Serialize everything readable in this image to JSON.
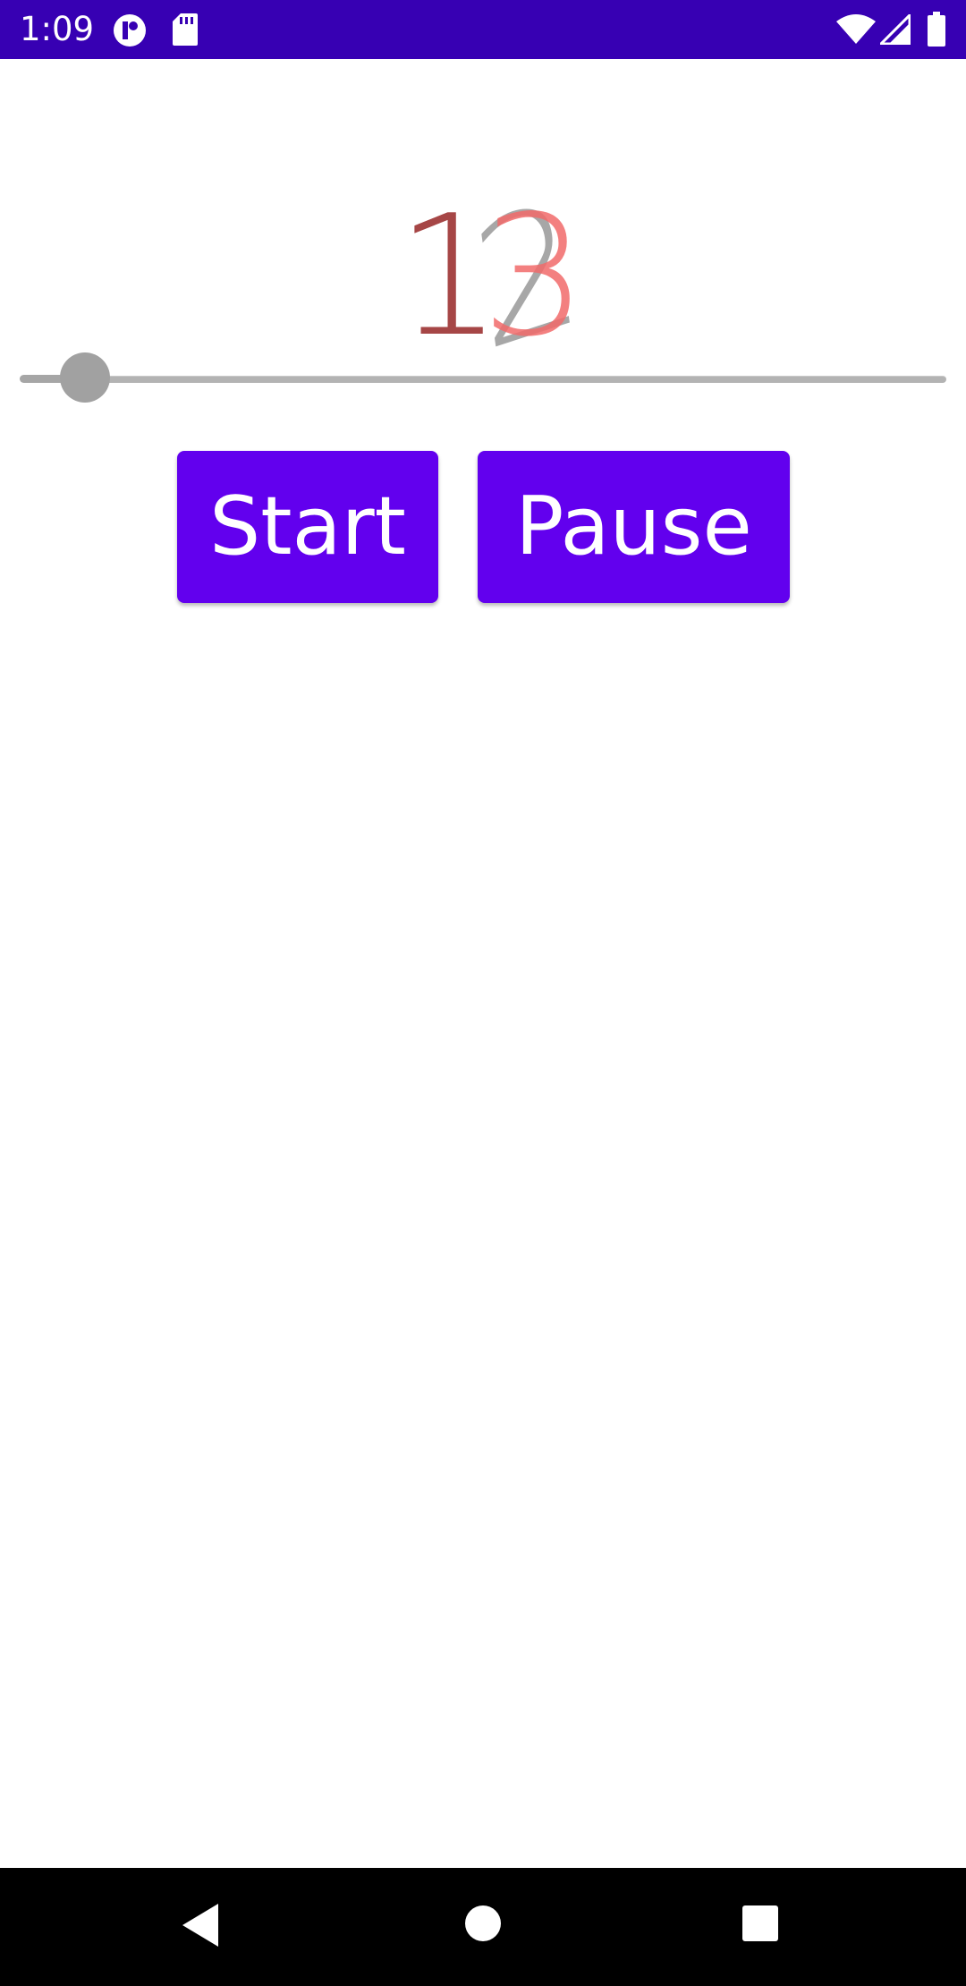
{
  "status_bar": {
    "time": "1:09",
    "background": "#3700b3",
    "icons": [
      "notification-app-icon",
      "sd-card-icon",
      "wifi-icon",
      "cell-signal-icon",
      "battery-icon"
    ]
  },
  "counter": {
    "previous_digits": [
      "1",
      "2"
    ],
    "current_digits": [
      "1",
      "3"
    ],
    "previous_color": "#9e9e9e",
    "current_color": "#f26b6b",
    "overlap_color": "#a64646"
  },
  "slider": {
    "value_fraction": 0.07,
    "thumb_color": "#a1a1a1"
  },
  "buttons": {
    "start_label": "Start",
    "pause_label": "Pause",
    "color": "#6200ee"
  },
  "nav_bar": {
    "icons": [
      "back-icon",
      "home-icon",
      "recents-icon"
    ]
  }
}
